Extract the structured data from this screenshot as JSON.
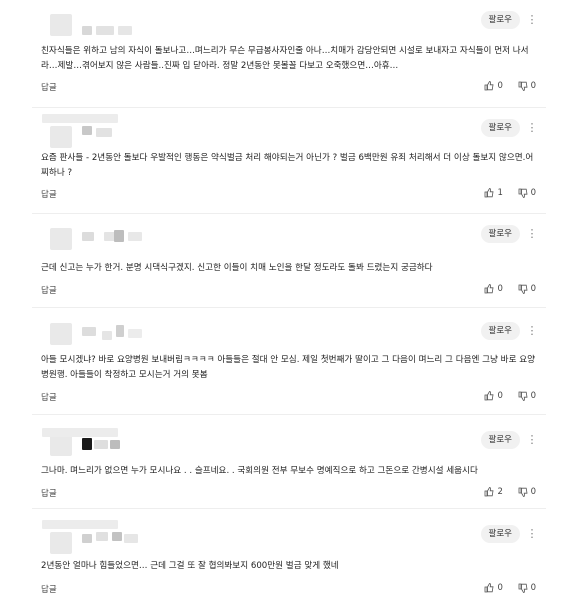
{
  "ui": {
    "follow_label": "팔로우",
    "reply_label": "답글",
    "more_icon": "⋮"
  },
  "comments": [
    {
      "text": "친자식들은 위하고 남의 자식이 돌보나고…며느리가 무슨 무급봉사자인줄 아나…치매가 감당안되면 시설로 보내자고 자식들이 먼저 나서라…제발…겪어보지 않은 사람들..진짜 입 닫아라. 정말 2년동안 못볼꼴 다보고 오죽했으면…아휴…",
      "likes": "0",
      "dislikes": "0"
    },
    {
      "text": "요즘 판사들 - 2년동안 돌보다 우발적인 행동은 약식벌금 처리 해야되는거 아닌가 ? 벌금 6백만원 유죄 처리해서 더 이상 돌보지 않으면.어찌하나 ?",
      "likes": "1",
      "dislikes": "0"
    },
    {
      "text": "근데 신고는 누가 한거. 분명 시댁식구겠지. 신고한 이들이 치매 노인을 한달 정도라도 돌봐 드렸는지 궁금하다",
      "likes": "0",
      "dislikes": "0"
    },
    {
      "text": "아들 모시겠냐? 바로 요양병원 보내버림ㅋㅋㅋㅋ 아들들은 절대 안 모심. 제일 첫번째가 딸이고 그 다음이 며느리 그 다음엔 그냥 바로 요양병원행. 아들들이 착정하고 모시는거 거의 못봄",
      "likes": "0",
      "dislikes": "0"
    },
    {
      "text": "그나마. 며느리가 없으면 누가 모시나요 . . 슬프네요. . 국회의원 전부 무보수 명예직으로 하고 그돈으로 간병시설 세웁시다",
      "likes": "2",
      "dislikes": "0"
    },
    {
      "text": "2년동안 얼마나 힘들었으면… 근데 그걸 또 잘 협의봐보지 600만원 벌금 맞게 했네",
      "likes": "0",
      "dislikes": "0"
    }
  ]
}
